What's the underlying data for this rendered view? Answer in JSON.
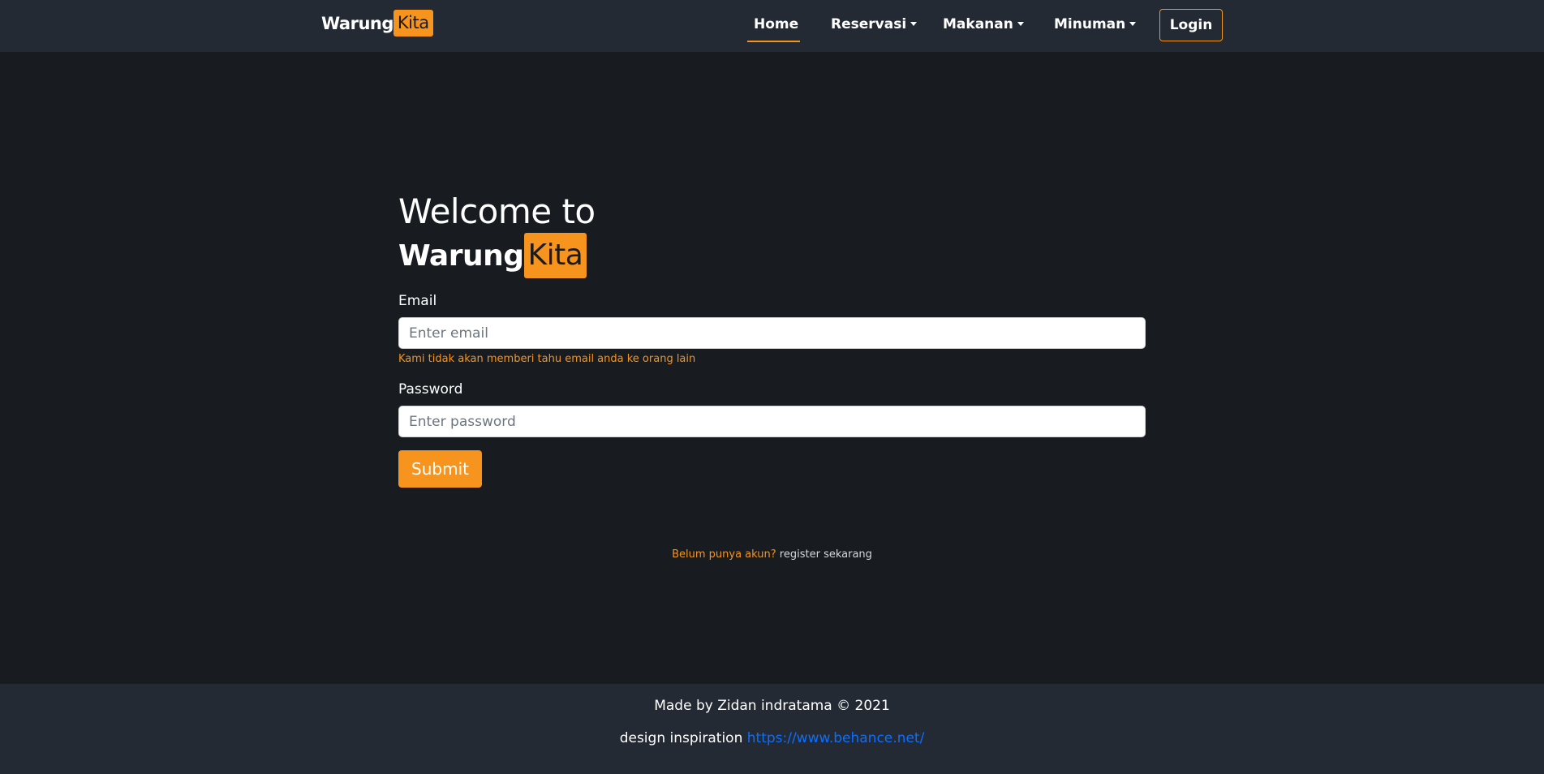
{
  "navbar": {
    "brand_part1": "Warung",
    "brand_part2": "Kita",
    "items": [
      {
        "label": "Home",
        "active": true
      },
      {
        "label": "Reservasi",
        "dropdown": true
      },
      {
        "label": "Makanan",
        "dropdown": true
      },
      {
        "label": "Minuman",
        "dropdown": true
      }
    ],
    "login_label": "Login"
  },
  "hero": {
    "welcome": "Welcome to",
    "brand_part1": "Warung",
    "brand_part2": "Kita"
  },
  "form": {
    "email_label": "Email",
    "email_placeholder": "Enter email",
    "email_help": "Kami tidak akan memberi tahu email anda ke orang lain",
    "password_label": "Password",
    "password_placeholder": "Enter password",
    "submit_label": "Submit"
  },
  "register": {
    "question": "Belum punya akun?",
    "link": "register sekarang"
  },
  "footer": {
    "credit": "Made by Zidan indratama © 2021",
    "inspiration_label": "design inspiration",
    "inspiration_link": "https://www.behance.net/"
  },
  "colors": {
    "accent": "#f7941d",
    "background": "#181c21",
    "navbar": "#232a33",
    "link": "#0d6efd"
  }
}
